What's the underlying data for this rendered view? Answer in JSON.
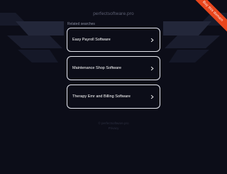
{
  "domain": "perfectsoftware.pro",
  "ribbon": "Buy this domain",
  "related_heading": "Related searches",
  "searches": [
    {
      "label": "Easy Payroll Software"
    },
    {
      "label": "Maintenance Shop Software"
    },
    {
      "label": "Therapy Emr and Billing Software"
    }
  ],
  "footer": {
    "line1": "© perfectsoftware.pro",
    "line2": "Privacy"
  },
  "colors": {
    "background": "#0c0d18",
    "card_border": "#e6e7ee",
    "ribbon": "#e8461d"
  }
}
